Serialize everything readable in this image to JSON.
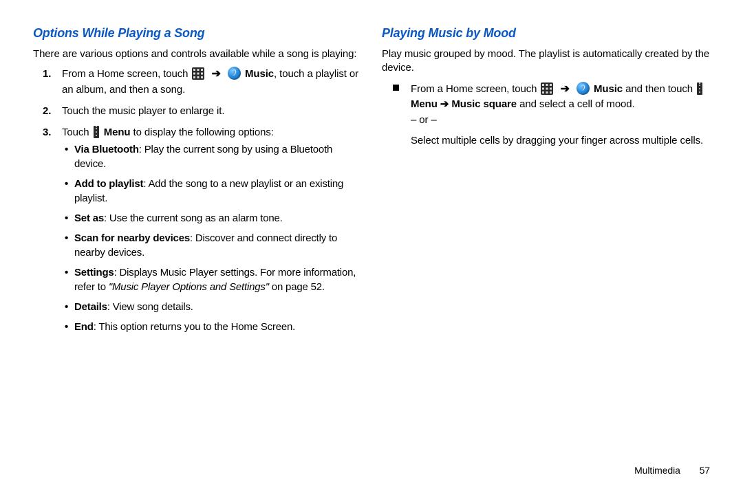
{
  "left": {
    "heading": "Options While Playing a Song",
    "intro": "There are various options and controls available while a song is playing:",
    "step1_a": "From a Home screen, touch ",
    "step1_music": "Music",
    "step1_b": ", touch a playlist or an album, and then a song.",
    "step2": "Touch the music player to enlarge it.",
    "step3_a": "Touch ",
    "step3_menu": "Menu",
    "step3_b": " to display the following options:",
    "bul": {
      "via_bt_b": "Via Bluetooth",
      "via_bt_t": ": Play the current song by using a Bluetooth device.",
      "add_b": "Add to playlist",
      "add_t": ": Add the song to a new playlist or an existing playlist.",
      "setas_b": "Set as",
      "setas_t": ": Use the current song as an alarm tone.",
      "scan_b": "Scan for nearby devices",
      "scan_t": ": Discover and connect directly to nearby devices.",
      "settings_b": "Settings",
      "settings_t1": ": Displays Music Player settings. For more information, refer to ",
      "settings_i": "\"Music Player Options and Settings\"",
      "settings_t2": " on page 52.",
      "details_b": "Details",
      "details_t": ": View song details.",
      "end_b": "End",
      "end_t": ": This option returns you to the Home Screen."
    }
  },
  "right": {
    "heading": "Playing Music by Mood",
    "intro": "Play music grouped by mood. The playlist is automatically created by the device.",
    "step_a": "From a Home screen, touch ",
    "music": "Music",
    "step_b": " and then touch ",
    "menu": "Menu",
    "arrow_txt": " ➔ ",
    "ms_b": "Music square",
    "step_c": " and select a cell of mood.",
    "or": "– or –",
    "step_d": "Select multiple cells by dragging your finger across multiple cells."
  },
  "footer": {
    "section": "Multimedia",
    "page": "57"
  },
  "arrow_glyph": "➔"
}
